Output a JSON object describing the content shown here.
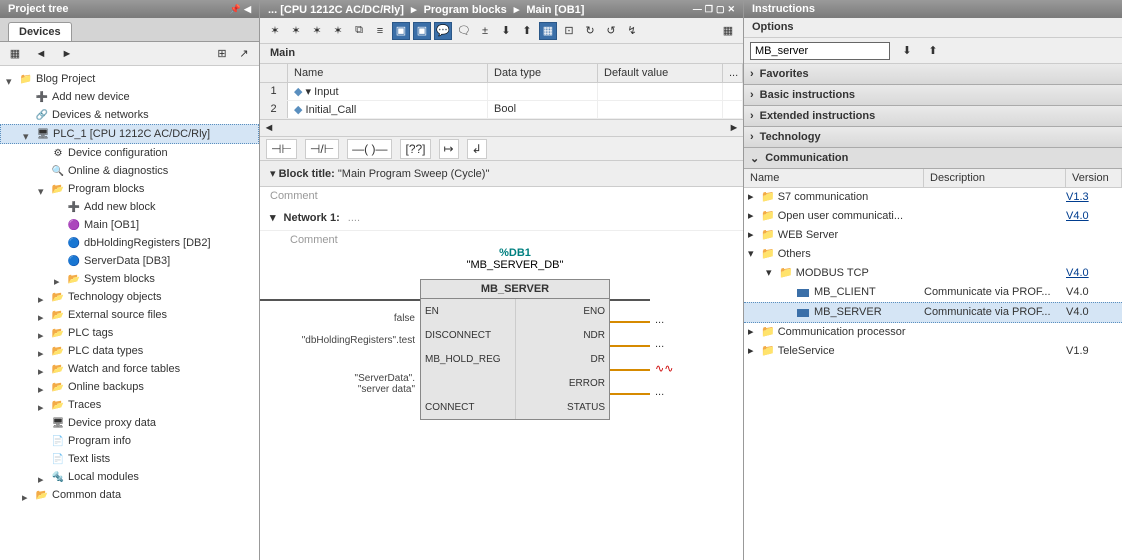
{
  "left": {
    "header": "Project tree",
    "tab": "Devices",
    "items": [
      {
        "ind": 0,
        "arr": "down",
        "ico": "📁",
        "label": "Blog Project"
      },
      {
        "ind": 1,
        "arr": "none",
        "ico": "➕",
        "label": "Add new device"
      },
      {
        "ind": 1,
        "arr": "none",
        "ico": "🔗",
        "label": "Devices & networks"
      },
      {
        "ind": 1,
        "arr": "down",
        "ico": "🖥",
        "label": "PLC_1 [CPU 1212C AC/DC/Rly]",
        "selected": true
      },
      {
        "ind": 2,
        "arr": "none",
        "ico": "⚙",
        "label": "Device configuration"
      },
      {
        "ind": 2,
        "arr": "none",
        "ico": "🔍",
        "label": "Online & diagnostics"
      },
      {
        "ind": 2,
        "arr": "down",
        "ico": "📂",
        "label": "Program blocks"
      },
      {
        "ind": 3,
        "arr": "none",
        "ico": "➕",
        "label": "Add new block"
      },
      {
        "ind": 3,
        "arr": "none",
        "ico": "🟣",
        "label": "Main [OB1]"
      },
      {
        "ind": 3,
        "arr": "none",
        "ico": "🔵",
        "label": "dbHoldingRegisters [DB2]"
      },
      {
        "ind": 3,
        "arr": "none",
        "ico": "🔵",
        "label": "ServerData [DB3]"
      },
      {
        "ind": 3,
        "arr": "right",
        "ico": "📂",
        "label": "System blocks"
      },
      {
        "ind": 2,
        "arr": "right",
        "ico": "📂",
        "label": "Technology objects"
      },
      {
        "ind": 2,
        "arr": "right",
        "ico": "📂",
        "label": "External source files"
      },
      {
        "ind": 2,
        "arr": "right",
        "ico": "📂",
        "label": "PLC tags"
      },
      {
        "ind": 2,
        "arr": "right",
        "ico": "📂",
        "label": "PLC data types"
      },
      {
        "ind": 2,
        "arr": "right",
        "ico": "📂",
        "label": "Watch and force tables"
      },
      {
        "ind": 2,
        "arr": "right",
        "ico": "📂",
        "label": "Online backups"
      },
      {
        "ind": 2,
        "arr": "right",
        "ico": "📂",
        "label": "Traces"
      },
      {
        "ind": 2,
        "arr": "none",
        "ico": "🖥",
        "label": "Device proxy data"
      },
      {
        "ind": 2,
        "arr": "none",
        "ico": "📄",
        "label": "Program info"
      },
      {
        "ind": 2,
        "arr": "none",
        "ico": "📄",
        "label": "Text lists"
      },
      {
        "ind": 2,
        "arr": "right",
        "ico": "🔩",
        "label": "Local modules"
      },
      {
        "ind": 1,
        "arr": "right",
        "ico": "📂",
        "label": "Common data"
      }
    ]
  },
  "mid": {
    "breadcrumb": {
      "a": "... [CPU 1212C AC/DC/Rly]",
      "b": "Program blocks",
      "c": "Main [OB1]"
    },
    "main_label": "Main",
    "grid_hdr": {
      "name": "Name",
      "type": "Data type",
      "def": "Default value",
      "more": "..."
    },
    "grid_rows": [
      {
        "n": "1",
        "name": "▾ Input",
        "type": "",
        "def": ""
      },
      {
        "n": "2",
        "name": "    Initial_Call",
        "type": "Bool",
        "def": ""
      }
    ],
    "block_title_lbl": "Block title:",
    "block_title_val": "\"Main Program Sweep (Cycle)\"",
    "comment_lbl": "Comment",
    "network_lbl": "Network 1:",
    "network_name": "....",
    "fb": {
      "db": "%DB1",
      "dbname": "\"MB_SERVER_DB\"",
      "title": "MB_SERVER",
      "left": [
        "EN",
        "DISCONNECT",
        "MB_HOLD_REG",
        "",
        "CONNECT"
      ],
      "right": [
        "ENO",
        "NDR",
        "DR",
        "ERROR",
        "STATUS"
      ]
    },
    "in_false": "false",
    "in_hold": "\"dbHoldingRegisters\".test",
    "in_conn_a": "\"ServerData\".",
    "in_conn_b": "\"server data\""
  },
  "right": {
    "header": "Instructions",
    "options": "Options",
    "search": "MB_server",
    "cats": [
      "Favorites",
      "Basic instructions",
      "Extended instructions",
      "Technology"
    ],
    "open_cat": "Communication",
    "hdr": {
      "name": "Name",
      "desc": "Description",
      "ver": "Version"
    },
    "rows": [
      {
        "ind": 0,
        "arr": "right",
        "type": "folder",
        "name": "S7 communication",
        "desc": "",
        "ver": "V1.3",
        "link": true
      },
      {
        "ind": 0,
        "arr": "right",
        "type": "folder",
        "name": "Open user communicati...",
        "desc": "",
        "ver": "V4.0",
        "link": true
      },
      {
        "ind": 0,
        "arr": "right",
        "type": "folder",
        "name": "WEB Server",
        "desc": "",
        "ver": "",
        "link": false
      },
      {
        "ind": 0,
        "arr": "down",
        "type": "folder",
        "name": "Others",
        "desc": "",
        "ver": "",
        "link": false
      },
      {
        "ind": 1,
        "arr": "down",
        "type": "folder",
        "name": "MODBUS TCP",
        "desc": "",
        "ver": "V4.0",
        "link": true
      },
      {
        "ind": 2,
        "arr": "none",
        "type": "block",
        "name": "MB_CLIENT",
        "desc": "Communicate via PROF...",
        "ver": "V4.0",
        "link": false
      },
      {
        "ind": 2,
        "arr": "none",
        "type": "block",
        "name": "MB_SERVER",
        "desc": "Communicate via PROF...",
        "ver": "V4.0",
        "link": false,
        "selected": true
      },
      {
        "ind": 0,
        "arr": "right",
        "type": "folder",
        "name": "Communication processor",
        "desc": "",
        "ver": "",
        "link": false
      },
      {
        "ind": 0,
        "arr": "right",
        "type": "folder",
        "name": "TeleService",
        "desc": "",
        "ver": "V1.9",
        "link": false
      }
    ]
  }
}
